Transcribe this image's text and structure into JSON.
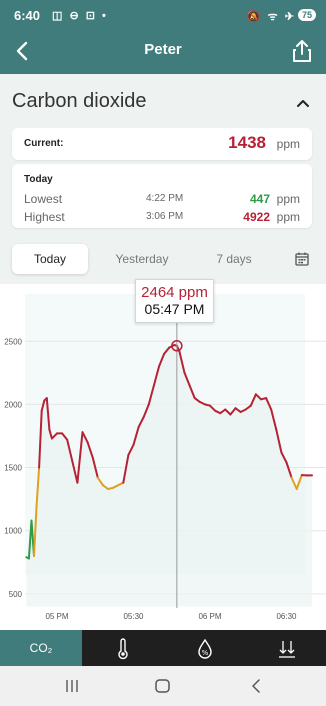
{
  "status_bar": {
    "time": "6:40",
    "left_icons": "◫ ⊖ ⊡ •",
    "right_icons": "🔕 ᯤ ✈",
    "battery": "75"
  },
  "header": {
    "title": "Peter",
    "back_icon": "chevron-left-icon",
    "share_icon": "share-icon"
  },
  "section": {
    "title": "Carbon dioxide",
    "collapse_icon": "chevron-up-icon"
  },
  "current": {
    "label": "Current:",
    "value": "1438",
    "unit": "ppm"
  },
  "today": {
    "label": "Today",
    "lowest": {
      "name": "Lowest",
      "time": "4:22 PM",
      "value": "447",
      "unit": "ppm"
    },
    "highest": {
      "name": "Highest",
      "time": "3:06 PM",
      "value": "4922",
      "unit": "ppm"
    }
  },
  "tabs": [
    {
      "label": "Today",
      "active": true
    },
    {
      "label": "Yesterday",
      "active": false
    },
    {
      "label": "7 days",
      "active": false
    }
  ],
  "tooltip": {
    "value": "2464 ppm",
    "time": "05:47 PM"
  },
  "colors": {
    "brand": "#3f7c7b",
    "high": "#b52235",
    "good": "#2e9b48",
    "moderate": "#e0a020"
  },
  "bottom_nav": [
    {
      "label": "CO₂",
      "icon": "co2-icon",
      "active": true
    },
    {
      "label": "",
      "icon": "thermometer-icon",
      "active": false
    },
    {
      "label": "",
      "icon": "humidity-percent-icon",
      "active": false
    },
    {
      "label": "",
      "icon": "pressure-arrows-icon",
      "active": false
    }
  ],
  "chart_data": {
    "type": "line",
    "title": "",
    "xlabel": "",
    "ylabel": "",
    "ylim": [
      400,
      2600
    ],
    "y_ticks": [
      500,
      1000,
      1500,
      2000,
      2500
    ],
    "x_ticks": [
      "05 PM",
      "05:30",
      "06 PM",
      "06:30"
    ],
    "series": [
      {
        "values_x_minutes_from_5pm": [
          -12,
          -11,
          -10,
          -9,
          -8,
          -7,
          -6,
          -5,
          -4,
          -3,
          -2,
          0,
          2,
          4,
          6,
          8,
          10,
          12,
          14,
          16,
          18,
          20,
          22,
          24,
          26,
          28,
          30,
          32,
          34,
          36,
          38,
          40,
          42,
          44,
          46,
          47,
          48,
          50,
          52,
          54,
          56,
          58,
          60,
          62,
          64,
          66,
          68,
          70,
          72,
          74,
          76,
          78,
          80,
          82,
          84,
          86,
          88,
          90,
          92,
          94,
          96,
          98,
          100
        ],
        "x": [
          "4:48",
          "4:49",
          "4:50",
          "4:51",
          "4:52",
          "4:53",
          "4:54",
          "4:55",
          "4:56",
          "4:57",
          "4:58",
          "5:00",
          "5:02",
          "5:04",
          "5:06",
          "5:08",
          "5:10",
          "5:12",
          "5:14",
          "5:16",
          "5:18",
          "5:20",
          "5:22",
          "5:24",
          "5:26",
          "5:28",
          "5:30",
          "5:32",
          "5:34",
          "5:36",
          "5:38",
          "5:40",
          "5:42",
          "5:44",
          "5:46",
          "5:47",
          "5:48",
          "5:50",
          "5:52",
          "5:54",
          "5:56",
          "5:58",
          "6:00",
          "6:02",
          "6:04",
          "6:06",
          "6:08",
          "6:10",
          "6:12",
          "6:14",
          "6:16",
          "6:18",
          "6:20",
          "6:22",
          "6:24",
          "6:26",
          "6:28",
          "6:30",
          "6:32",
          "6:34",
          "6:36",
          "6:38",
          "6:40"
        ],
        "values": [
          790,
          780,
          1080,
          800,
          1200,
          1500,
          1950,
          2030,
          2050,
          1800,
          1730,
          1770,
          1770,
          1720,
          1550,
          1380,
          1780,
          1700,
          1580,
          1420,
          1360,
          1330,
          1340,
          1360,
          1380,
          1600,
          1680,
          1820,
          1900,
          2000,
          2150,
          2300,
          2400,
          2450,
          2470,
          2464,
          2420,
          2250,
          2150,
          2050,
          2020,
          2000,
          1990,
          1950,
          1930,
          1960,
          1920,
          1970,
          1940,
          1960,
          1990,
          2080,
          2040,
          2050,
          1960,
          1800,
          1620,
          1540,
          1420,
          1330,
          1440,
          1438,
          1438
        ]
      }
    ]
  }
}
